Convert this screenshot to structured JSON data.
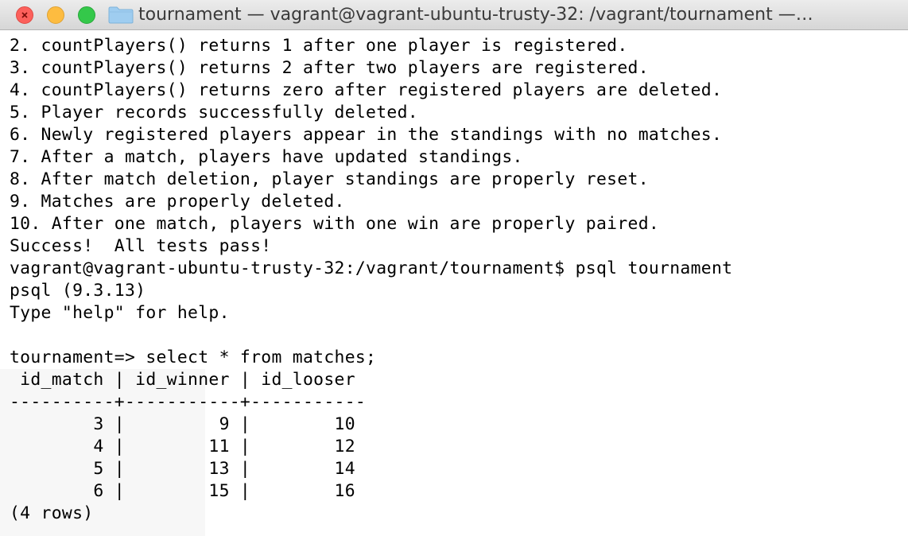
{
  "window": {
    "title": "tournament — vagrant@vagrant-ubuntu-trusty-32: /vagrant/tournament —…"
  },
  "terminal": {
    "lines": [
      "2. countPlayers() returns 1 after one player is registered.",
      "3. countPlayers() returns 2 after two players are registered.",
      "4. countPlayers() returns zero after registered players are deleted.",
      "5. Player records successfully deleted.",
      "6. Newly registered players appear in the standings with no matches.",
      "7. After a match, players have updated standings.",
      "8. After match deletion, player standings are properly reset.",
      "9. Matches are properly deleted.",
      "10. After one match, players with one win are properly paired.",
      "Success!  All tests pass!",
      "vagrant@vagrant-ubuntu-trusty-32:/vagrant/tournament$ psql tournament",
      "psql (9.3.13)",
      "Type \"help\" for help.",
      "",
      "tournament=> select * from matches;",
      " id_match | id_winner | id_looser",
      "----------+-----------+-----------",
      "        3 |         9 |        10",
      "        4 |        11 |        12",
      "        5 |        13 |        14",
      "        6 |        15 |        16",
      "(4 rows)"
    ]
  }
}
